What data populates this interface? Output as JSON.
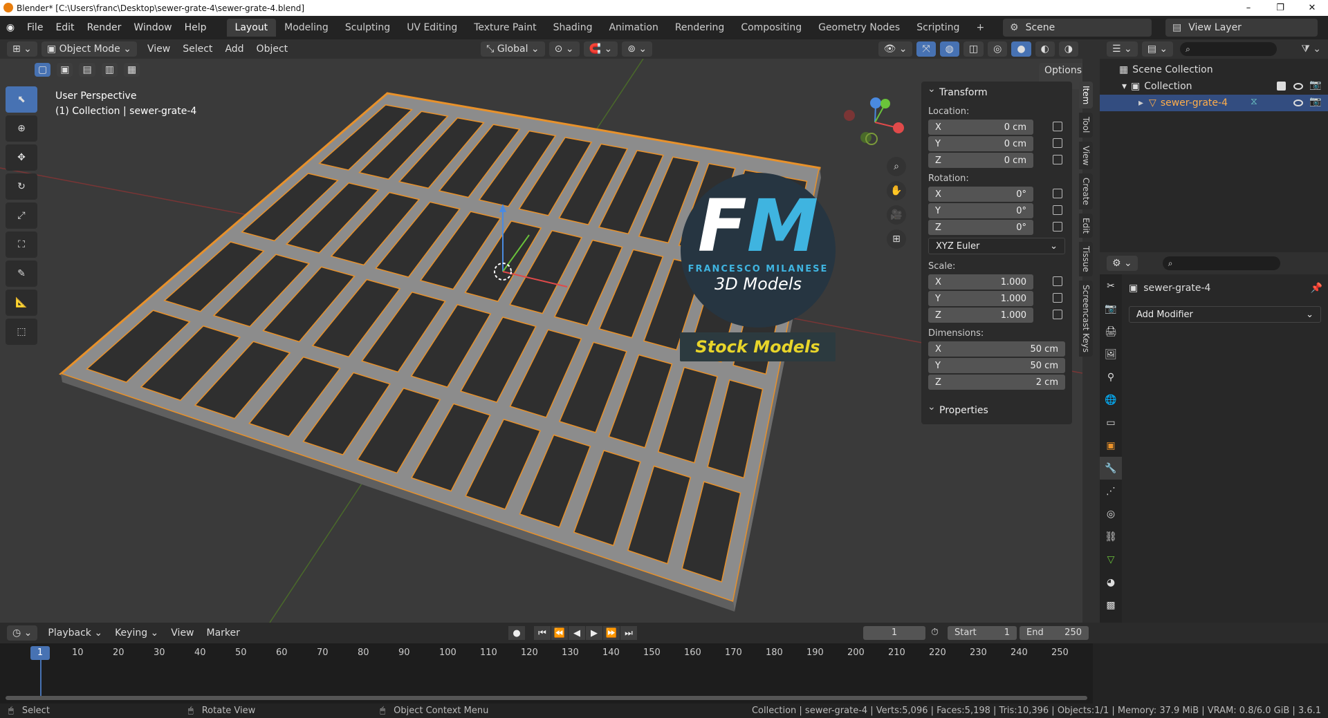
{
  "window": {
    "title": "Blender* [C:\\Users\\franc\\Desktop\\sewer-grate-4\\sewer-grate-4.blend]",
    "minimize": "–",
    "maximize": "❐",
    "close": "✕"
  },
  "menu": [
    "File",
    "Edit",
    "Render",
    "Window",
    "Help"
  ],
  "workspaces": [
    "Layout",
    "Modeling",
    "Sculpting",
    "UV Editing",
    "Texture Paint",
    "Shading",
    "Animation",
    "Rendering",
    "Compositing",
    "Geometry Nodes",
    "Scripting"
  ],
  "active_workspace": "Layout",
  "scene": {
    "label": "Scene",
    "view_layer": "View Layer"
  },
  "viewport_header": {
    "mode": "Object Mode",
    "menus": [
      "View",
      "Select",
      "Add",
      "Object"
    ],
    "orientation": "Global",
    "options": "Options"
  },
  "viewport_overlay": {
    "line1": "User Perspective",
    "line2": "(1) Collection | sewer-grate-4"
  },
  "n_panel": {
    "transform_title": "Transform",
    "location_label": "Location:",
    "location": [
      {
        "axis": "X",
        "value": "0 cm"
      },
      {
        "axis": "Y",
        "value": "0 cm"
      },
      {
        "axis": "Z",
        "value": "0 cm"
      }
    ],
    "rotation_label": "Rotation:",
    "rotation": [
      {
        "axis": "X",
        "value": "0°"
      },
      {
        "axis": "Y",
        "value": "0°"
      },
      {
        "axis": "Z",
        "value": "0°"
      }
    ],
    "rotation_mode": "XYZ Euler",
    "scale_label": "Scale:",
    "scale": [
      {
        "axis": "X",
        "value": "1.000"
      },
      {
        "axis": "Y",
        "value": "1.000"
      },
      {
        "axis": "Z",
        "value": "1.000"
      }
    ],
    "dimensions_label": "Dimensions:",
    "dimensions": [
      {
        "axis": "X",
        "value": "50 cm"
      },
      {
        "axis": "Y",
        "value": "50 cm"
      },
      {
        "axis": "Z",
        "value": "2 cm"
      }
    ],
    "properties_title": "Properties"
  },
  "side_tabs": [
    "Item",
    "Tool",
    "View",
    "Create",
    "Edit",
    "Tissue",
    "Screencast Keys"
  ],
  "watermark": {
    "fm_f": "F",
    "fm_m": "M",
    "name": "FRANCESCO MILANESE",
    "models": "3D Models",
    "stock": "Stock Models"
  },
  "outliner": {
    "scene_collection": "Scene Collection",
    "collection": "Collection",
    "object": "sewer-grate-4"
  },
  "properties": {
    "object_name": "sewer-grate-4",
    "add_modifier": "Add Modifier"
  },
  "timeline": {
    "menus": [
      "Playback",
      "Keying",
      "View",
      "Marker"
    ],
    "current_frame": "1",
    "start_label": "Start",
    "start": "1",
    "end_label": "End",
    "end": "250",
    "ticks": [
      "10",
      "20",
      "30",
      "40",
      "50",
      "60",
      "70",
      "80",
      "90",
      "100",
      "110",
      "120",
      "130",
      "140",
      "150",
      "160",
      "170",
      "180",
      "190",
      "200",
      "210",
      "220",
      "230",
      "240",
      "250"
    ]
  },
  "status_bar": {
    "select": "Select",
    "rotate": "Rotate View",
    "context": "Object Context Menu",
    "stats": "Collection | sewer-grate-4 | Verts:5,096 | Faces:5,198 | Tris:10,396 | Objects:1/1 | Memory: 37.9 MiB | VRAM: 0.8/6.0 GiB | 3.6.1"
  },
  "colors": {
    "accent": "#4772b3",
    "selection": "#ffae4a",
    "background": "#303030"
  }
}
